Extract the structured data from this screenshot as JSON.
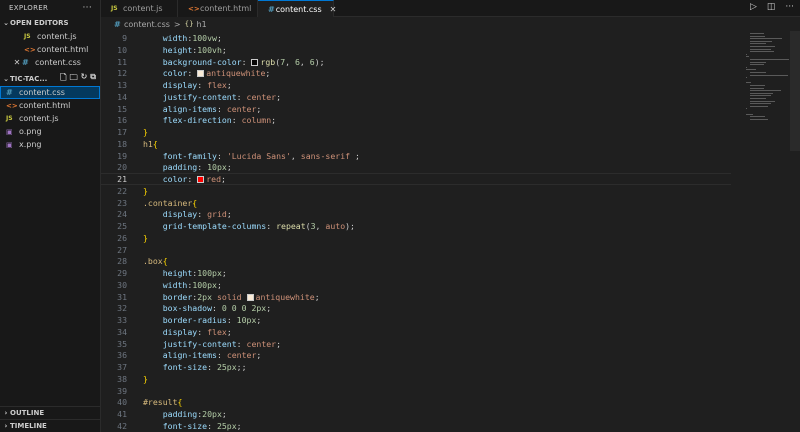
{
  "sidebar": {
    "title": "EXPLORER",
    "more": "···",
    "open_editors": {
      "label": "OPEN EDITORS",
      "items": [
        {
          "icon_text": "JS",
          "icon": "js-file-icon",
          "name": "content.js"
        },
        {
          "icon_text": "<>",
          "icon": "html-file-icon",
          "name": "content.html"
        },
        {
          "icon_text": "#",
          "icon": "css-file-icon",
          "name": "content.css",
          "close": "✕"
        }
      ]
    },
    "folder": {
      "label": "TIC-TAC...",
      "items": [
        {
          "icon_text": "#",
          "icon": "css-file-icon",
          "name": "content.css"
        },
        {
          "icon_text": "<>",
          "icon": "html-file-icon",
          "name": "content.html"
        },
        {
          "icon_text": "JS",
          "icon": "js-file-icon",
          "name": "content.js"
        },
        {
          "icon_text": "▣",
          "icon": "image-file-icon",
          "name": "o.png"
        },
        {
          "icon_text": "▣",
          "icon": "image-file-icon",
          "name": "x.png"
        }
      ]
    },
    "outline_label": "OUTLINE",
    "timeline_label": "TIMELINE"
  },
  "tabs": [
    {
      "icon_text": "JS",
      "label": "content.js"
    },
    {
      "icon_text": "<>",
      "label": "content.html"
    },
    {
      "icon_text": "#",
      "label": "content.css",
      "close": "✕"
    }
  ],
  "breadcrumb": {
    "file_icon": "#",
    "file": "content.css",
    "sep": ">",
    "symbol_icon": "{}",
    "symbol": "h1"
  },
  "code_lines": [
    {
      "n": "9",
      "indent": "    ",
      "tokens": [
        {
          "c": "prop",
          "t": "width"
        },
        {
          "c": "punc",
          "t": ":"
        },
        {
          "c": "num",
          "t": "100vw"
        },
        {
          "c": "punc",
          "t": ";"
        }
      ]
    },
    {
      "n": "10",
      "indent": "    ",
      "tokens": [
        {
          "c": "prop",
          "t": "height"
        },
        {
          "c": "punc",
          "t": ":"
        },
        {
          "c": "num",
          "t": "100vh"
        },
        {
          "c": "punc",
          "t": ";"
        }
      ]
    },
    {
      "n": "11",
      "indent": "    ",
      "tokens": [
        {
          "c": "prop",
          "t": "background-color"
        },
        {
          "c": "punc",
          "t": ": "
        },
        {
          "c": "swatch",
          "t": "#070606"
        },
        {
          "c": "fn",
          "t": "rgb"
        },
        {
          "c": "punc",
          "t": "("
        },
        {
          "c": "num",
          "t": "7"
        },
        {
          "c": "punc",
          "t": ", "
        },
        {
          "c": "num",
          "t": "6"
        },
        {
          "c": "punc",
          "t": ", "
        },
        {
          "c": "num",
          "t": "6"
        },
        {
          "c": "punc",
          "t": ");"
        }
      ]
    },
    {
      "n": "12",
      "indent": "    ",
      "tokens": [
        {
          "c": "prop",
          "t": "color"
        },
        {
          "c": "punc",
          "t": ": "
        },
        {
          "c": "swatch",
          "t": "#faebd7"
        },
        {
          "c": "val",
          "t": "antiquewhite"
        },
        {
          "c": "punc",
          "t": ";"
        }
      ]
    },
    {
      "n": "13",
      "indent": "    ",
      "tokens": [
        {
          "c": "prop",
          "t": "display"
        },
        {
          "c": "punc",
          "t": ": "
        },
        {
          "c": "val",
          "t": "flex"
        },
        {
          "c": "punc",
          "t": ";"
        }
      ]
    },
    {
      "n": "14",
      "indent": "    ",
      "tokens": [
        {
          "c": "prop",
          "t": "justify-content"
        },
        {
          "c": "punc",
          "t": ": "
        },
        {
          "c": "val",
          "t": "center"
        },
        {
          "c": "punc",
          "t": ";"
        }
      ]
    },
    {
      "n": "15",
      "indent": "    ",
      "tokens": [
        {
          "c": "prop",
          "t": "align-items"
        },
        {
          "c": "punc",
          "t": ": "
        },
        {
          "c": "val",
          "t": "center"
        },
        {
          "c": "punc",
          "t": ";"
        }
      ]
    },
    {
      "n": "16",
      "indent": "    ",
      "tokens": [
        {
          "c": "prop",
          "t": "flex-direction"
        },
        {
          "c": "punc",
          "t": ": "
        },
        {
          "c": "val",
          "t": "column"
        },
        {
          "c": "punc",
          "t": ";"
        }
      ]
    },
    {
      "n": "17",
      "indent": "",
      "tokens": [
        {
          "c": "brace",
          "t": "}"
        }
      ]
    },
    {
      "n": "18",
      "indent": "",
      "tokens": [
        {
          "c": "sel",
          "t": "h1"
        },
        {
          "c": "brace",
          "t": "{"
        }
      ]
    },
    {
      "n": "19",
      "indent": "    ",
      "tokens": [
        {
          "c": "prop",
          "t": "font-family"
        },
        {
          "c": "punc",
          "t": ": "
        },
        {
          "c": "val",
          "t": "'Lucida Sans'"
        },
        {
          "c": "punc",
          "t": ", "
        },
        {
          "c": "val",
          "t": "sans-serif"
        },
        {
          "c": "punc",
          "t": " ;"
        }
      ]
    },
    {
      "n": "20",
      "indent": "    ",
      "tokens": [
        {
          "c": "prop",
          "t": "padding"
        },
        {
          "c": "punc",
          "t": ": "
        },
        {
          "c": "num",
          "t": "10px"
        },
        {
          "c": "punc",
          "t": ";"
        }
      ]
    },
    {
      "n": "21",
      "indent": "    ",
      "current": true,
      "tokens": [
        {
          "c": "prop",
          "t": "color"
        },
        {
          "c": "punc",
          "t": ": "
        },
        {
          "c": "swatch",
          "t": "#ff0000"
        },
        {
          "c": "val",
          "t": "red"
        },
        {
          "c": "punc",
          "t": ";"
        }
      ]
    },
    {
      "n": "22",
      "indent": "",
      "tokens": [
        {
          "c": "brace",
          "t": "}"
        }
      ]
    },
    {
      "n": "23",
      "indent": "",
      "tokens": [
        {
          "c": "sel",
          "t": ".container"
        },
        {
          "c": "brace",
          "t": "{"
        }
      ]
    },
    {
      "n": "24",
      "indent": "    ",
      "tokens": [
        {
          "c": "prop",
          "t": "display"
        },
        {
          "c": "punc",
          "t": ": "
        },
        {
          "c": "val",
          "t": "grid"
        },
        {
          "c": "punc",
          "t": ";"
        }
      ]
    },
    {
      "n": "25",
      "indent": "    ",
      "tokens": [
        {
          "c": "prop",
          "t": "grid-template-columns"
        },
        {
          "c": "punc",
          "t": ": "
        },
        {
          "c": "fn",
          "t": "repeat"
        },
        {
          "c": "punc",
          "t": "("
        },
        {
          "c": "num",
          "t": "3"
        },
        {
          "c": "punc",
          "t": ", "
        },
        {
          "c": "val",
          "t": "auto"
        },
        {
          "c": "punc",
          "t": ");"
        }
      ]
    },
    {
      "n": "26",
      "indent": "",
      "tokens": [
        {
          "c": "brace",
          "t": "}"
        }
      ]
    },
    {
      "n": "27",
      "indent": "",
      "tokens": []
    },
    {
      "n": "28",
      "indent": "",
      "tokens": [
        {
          "c": "sel",
          "t": ".box"
        },
        {
          "c": "brace",
          "t": "{"
        }
      ]
    },
    {
      "n": "29",
      "indent": "    ",
      "tokens": [
        {
          "c": "prop",
          "t": "height"
        },
        {
          "c": "punc",
          "t": ":"
        },
        {
          "c": "num",
          "t": "100px"
        },
        {
          "c": "punc",
          "t": ";"
        }
      ]
    },
    {
      "n": "30",
      "indent": "    ",
      "tokens": [
        {
          "c": "prop",
          "t": "width"
        },
        {
          "c": "punc",
          "t": ":"
        },
        {
          "c": "num",
          "t": "100px"
        },
        {
          "c": "punc",
          "t": ";"
        }
      ]
    },
    {
      "n": "31",
      "indent": "    ",
      "tokens": [
        {
          "c": "prop",
          "t": "border"
        },
        {
          "c": "punc",
          "t": ":"
        },
        {
          "c": "num",
          "t": "2px"
        },
        {
          "c": "val",
          "t": " solid "
        },
        {
          "c": "swatch",
          "t": "#faebd7"
        },
        {
          "c": "val",
          "t": "antiquewhite"
        },
        {
          "c": "punc",
          "t": ";"
        }
      ]
    },
    {
      "n": "32",
      "indent": "    ",
      "tokens": [
        {
          "c": "prop",
          "t": "box-shadow"
        },
        {
          "c": "punc",
          "t": ": "
        },
        {
          "c": "num",
          "t": "0 0 0 2px"
        },
        {
          "c": "punc",
          "t": ";"
        }
      ]
    },
    {
      "n": "33",
      "indent": "    ",
      "tokens": [
        {
          "c": "prop",
          "t": "border-radius"
        },
        {
          "c": "punc",
          "t": ": "
        },
        {
          "c": "num",
          "t": "10px"
        },
        {
          "c": "punc",
          "t": ";"
        }
      ]
    },
    {
      "n": "34",
      "indent": "    ",
      "tokens": [
        {
          "c": "prop",
          "t": "display"
        },
        {
          "c": "punc",
          "t": ": "
        },
        {
          "c": "val",
          "t": "flex"
        },
        {
          "c": "punc",
          "t": ";"
        }
      ]
    },
    {
      "n": "35",
      "indent": "    ",
      "tokens": [
        {
          "c": "prop",
          "t": "justify-content"
        },
        {
          "c": "punc",
          "t": ": "
        },
        {
          "c": "val",
          "t": "center"
        },
        {
          "c": "punc",
          "t": ";"
        }
      ]
    },
    {
      "n": "36",
      "indent": "    ",
      "tokens": [
        {
          "c": "prop",
          "t": "align-items"
        },
        {
          "c": "punc",
          "t": ": "
        },
        {
          "c": "val",
          "t": "center"
        },
        {
          "c": "punc",
          "t": ";"
        }
      ]
    },
    {
      "n": "37",
      "indent": "    ",
      "tokens": [
        {
          "c": "prop",
          "t": "font-size"
        },
        {
          "c": "punc",
          "t": ": "
        },
        {
          "c": "num",
          "t": "25px"
        },
        {
          "c": "punc",
          "t": ";;"
        }
      ]
    },
    {
      "n": "38",
      "indent": "",
      "tokens": [
        {
          "c": "brace",
          "t": "}"
        }
      ]
    },
    {
      "n": "39",
      "indent": "",
      "tokens": []
    },
    {
      "n": "40",
      "indent": "",
      "tokens": [
        {
          "c": "sel",
          "t": "#result"
        },
        {
          "c": "brace",
          "t": "{"
        }
      ]
    },
    {
      "n": "41",
      "indent": "    ",
      "tokens": [
        {
          "c": "prop",
          "t": "padding"
        },
        {
          "c": "punc",
          "t": ":"
        },
        {
          "c": "num",
          "t": "20px"
        },
        {
          "c": "punc",
          "t": ";"
        }
      ]
    },
    {
      "n": "42",
      "indent": "    ",
      "tokens": [
        {
          "c": "prop",
          "t": "font-size"
        },
        {
          "c": "punc",
          "t": ": "
        },
        {
          "c": "num",
          "t": "25px"
        },
        {
          "c": "punc",
          "t": ";"
        }
      ]
    }
  ],
  "colors": {
    "accent": "#0078d4",
    "selection": "#04395e",
    "editor_bg": "#1f1f1f",
    "sidebar_bg": "#181818"
  }
}
